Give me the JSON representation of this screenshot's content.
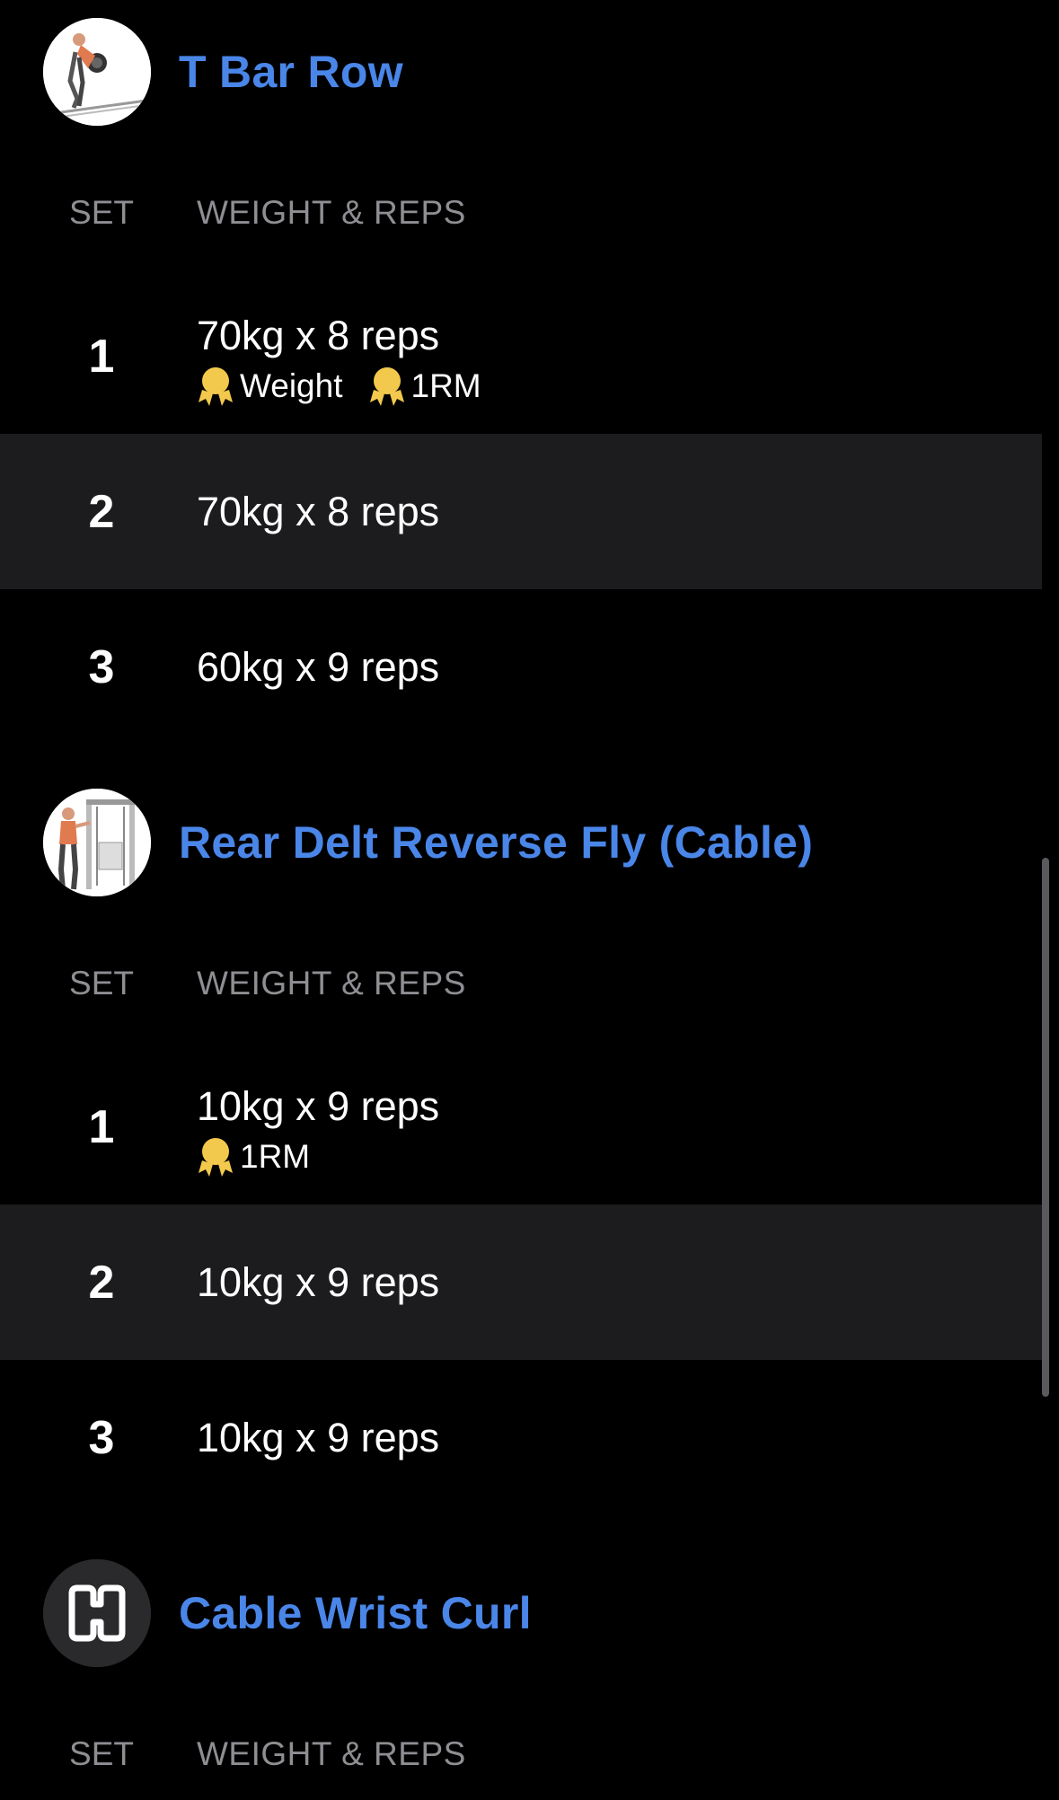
{
  "accent_color": "#4a86e8",
  "row_alt_color": "#1c1c1e",
  "medal_color": "#f2c94c",
  "exercises": [
    {
      "title": "T Bar Row",
      "thumbnail_icon": "t-bar-row-illustration",
      "set_header": "SET",
      "weight_reps_header": "WEIGHT & REPS",
      "sets": [
        {
          "num": "1",
          "value": "70kg x 8 reps",
          "badges": [
            "Weight",
            "1RM"
          ]
        },
        {
          "num": "2",
          "value": "70kg x 8 reps",
          "badges": []
        },
        {
          "num": "3",
          "value": "60kg x 9 reps",
          "badges": []
        }
      ]
    },
    {
      "title": "Rear Delt Reverse Fly (Cable)",
      "thumbnail_icon": "cable-machine-illustration",
      "set_header": "SET",
      "weight_reps_header": "WEIGHT & REPS",
      "sets": [
        {
          "num": "1",
          "value": "10kg x 9 reps",
          "badges": [
            "1RM"
          ]
        },
        {
          "num": "2",
          "value": "10kg x 9 reps",
          "badges": []
        },
        {
          "num": "3",
          "value": "10kg x 9 reps",
          "badges": []
        }
      ]
    },
    {
      "title": "Cable Wrist Curl",
      "thumbnail_icon": "app-logo-icon",
      "set_header": "SET",
      "weight_reps_header": "WEIGHT & REPS",
      "sets": []
    }
  ]
}
